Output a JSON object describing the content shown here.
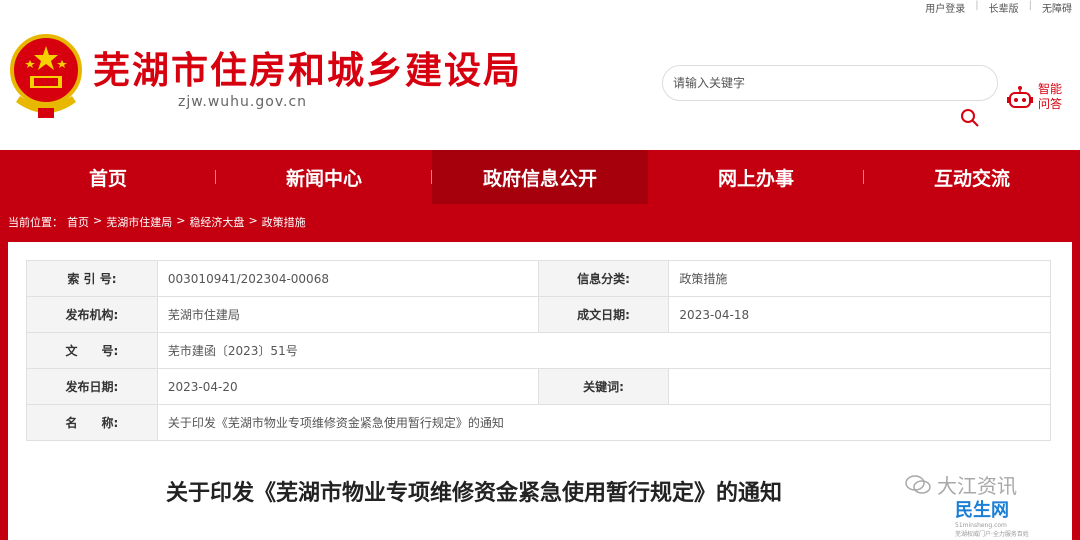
{
  "topbar": {
    "links": [
      "用户登录",
      "长辈版",
      "无障碍"
    ]
  },
  "header": {
    "title": "芜湖市住房和城乡建设局",
    "domain": "zjw.wuhu.gov.cn",
    "search_placeholder": "请输入关键字",
    "ai_label_line1": "智能",
    "ai_label_line2": "问答"
  },
  "nav": {
    "items": [
      "首页",
      "新闻中心",
      "政府信息公开",
      "网上办事",
      "互动交流"
    ],
    "active_index": 2
  },
  "breadcrumb": {
    "prefix": "当前位置：",
    "items": [
      "首页",
      "芜湖市住建局",
      "稳经济大盘",
      "政策措施"
    ],
    "separator": ">"
  },
  "meta": {
    "index_label": "索 引 号:",
    "index_value": "003010941/202304-00068",
    "category_label": "信息分类:",
    "category_value": "政策措施",
    "issuer_label": "发布机构:",
    "issuer_value": "芜湖市住建局",
    "created_label": "成文日期:",
    "created_value": "2023-04-18",
    "docno_label": "文　　号:",
    "docno_value": "芜市建函〔2023〕51号",
    "published_label": "发布日期:",
    "published_value": "2023-04-20",
    "keywords_label": "关键词:",
    "keywords_value": "",
    "name_label": "名　　称:",
    "name_value": "关于印发《芜湖市物业专项维修资金紧急使用暂行规定》的通知"
  },
  "document": {
    "title": "关于印发《芜湖市物业专项维修资金紧急使用暂行规定》的通知"
  },
  "watermark": {
    "text": "大江资讯",
    "logo_text": "民生网",
    "logo_url_text": "51minsheng.com",
    "logo_slogan": "芜湖权威门户·全力服务百姓"
  },
  "colors": {
    "brand_red": "#c40010",
    "title_red": "#d7000f"
  }
}
